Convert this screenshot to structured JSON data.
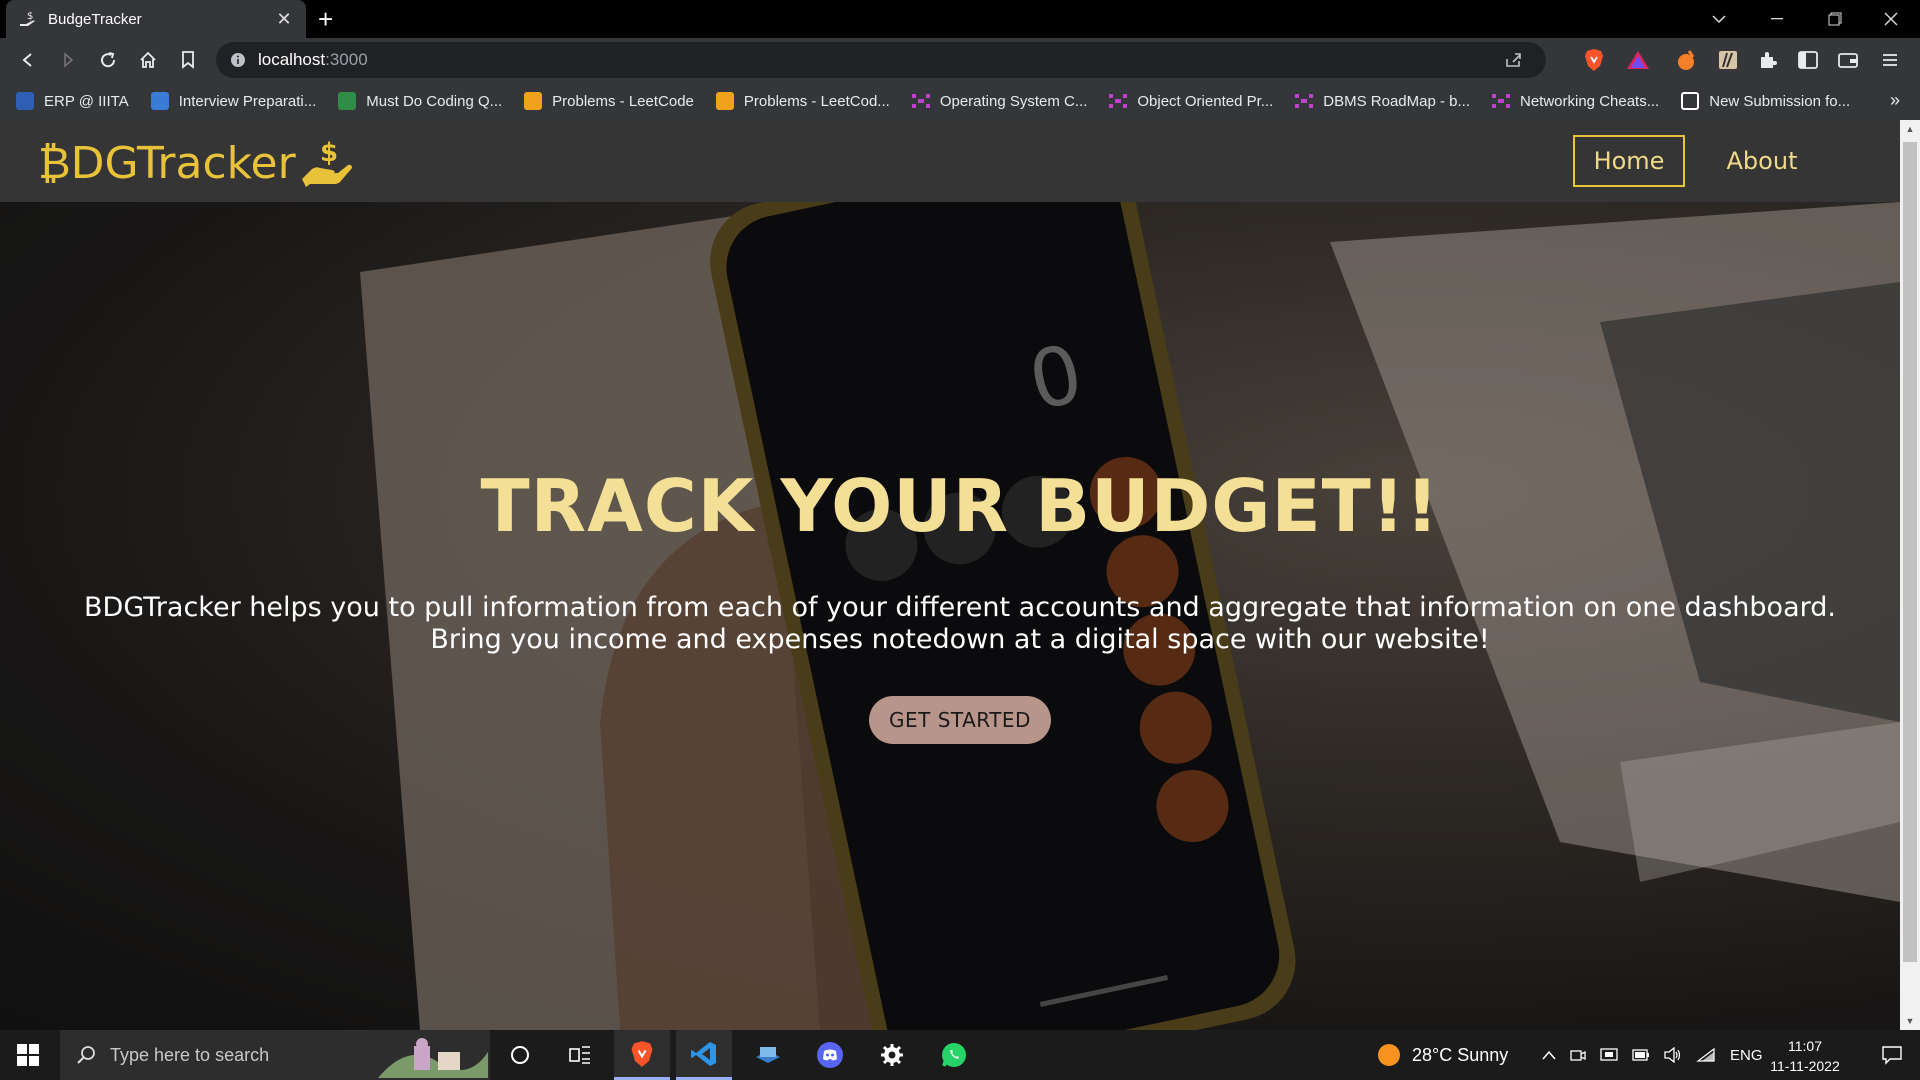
{
  "browser": {
    "tab_title": "BudgeTracker",
    "tab_close": "✕",
    "new_tab": "+",
    "url_host": "localhost",
    "url_port": ":3000",
    "bookmarks": [
      {
        "label": "ERP @ IIITA",
        "icon": "erp-icon",
        "color": "#2f5fb3"
      },
      {
        "label": "Interview Preparati...",
        "icon": "leetcode-l-icon",
        "color": "#3a7bd5"
      },
      {
        "label": "Must Do Coding Q...",
        "icon": "gfg-icon",
        "color": "#2f8d46"
      },
      {
        "label": "Problems - LeetCode",
        "icon": "leetcode-icon",
        "color": "#f0a31a"
      },
      {
        "label": "Problems - LeetCod...",
        "icon": "leetcode-icon",
        "color": "#f0a31a"
      },
      {
        "label": "Operating System C...",
        "icon": "notion-dots-icon",
        "color": "#c33fd1"
      },
      {
        "label": "Object Oriented Pr...",
        "icon": "notion-dots-icon",
        "color": "#c33fd1"
      },
      {
        "label": "DBMS RoadMap - b...",
        "icon": "notion-dots-icon",
        "color": "#c33fd1"
      },
      {
        "label": "Networking Cheats...",
        "icon": "notion-dots-icon",
        "color": "#c33fd1"
      },
      {
        "label": "New Submission fo...",
        "icon": "form-icon",
        "color": "#ffffff"
      }
    ],
    "bookmarks_more": "»"
  },
  "site": {
    "brand": "₿DGTracker",
    "nav": {
      "home": "Home",
      "about": "About"
    },
    "hero": {
      "headline": "TRACK YOUR BUDGET!!",
      "subtext_line1": "BDGTracker helps you to pull information from each of your different accounts and aggregate that information on one dashboard.",
      "subtext_line2": "Bring you income and expenses notedown at a digital space with our website!",
      "cta": "GET STARTED"
    },
    "colors": {
      "accent": "#e8c33a",
      "navbar": "#353535",
      "cta_bg": "#b8958a"
    }
  },
  "taskbar": {
    "search_placeholder": "Type here to search",
    "weather": "28°C  Sunny",
    "language": "ENG",
    "time": "11:07",
    "date": "11-11-2022"
  }
}
